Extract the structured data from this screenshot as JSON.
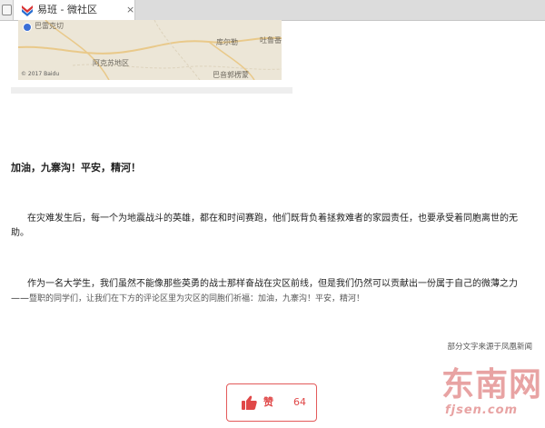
{
  "browser": {
    "tab_title": "易班 - 微社区",
    "tab_close": "×",
    "tab_icon": "yiban-logo-icon"
  },
  "map": {
    "labels": [
      "巴雷克切",
      "阿克苏地区",
      "库尔勒",
      "吐鲁番",
      "巴音郭楞蒙"
    ],
    "logo": "© 2017 Baidu",
    "colors": {
      "land": "#ece6d7",
      "roads": "#e9c98a",
      "marker": "#3b6fd6"
    }
  },
  "article": {
    "heading": "加油，九寨沟！平安，精河！",
    "paragraph1": "在灾难发生后，每一个为地震战斗的英雄，都在和时间赛跑，他们既背负着拯救难者的家园责任，也要承受着同胞离世的无助。",
    "paragraph2_main": "作为一名大学生，我们虽然不能像那些英勇的战士那样奋战在灾区前线，但是我们仍然可以贡献出一份属于自己的微薄之力——",
    "paragraph2_tail": "暨职的同学们，让我们在下方的评论区里为灾区的同胞们祈福：加油，九寨沟！平安，精河！",
    "source": "部分文字来源于凤凰新闻"
  },
  "like": {
    "label": "赞",
    "count": "64",
    "icon": "thumbs-up-icon",
    "color": "#e04848"
  },
  "watermark": {
    "text": "东南网",
    "sub": "fjsen.com"
  }
}
